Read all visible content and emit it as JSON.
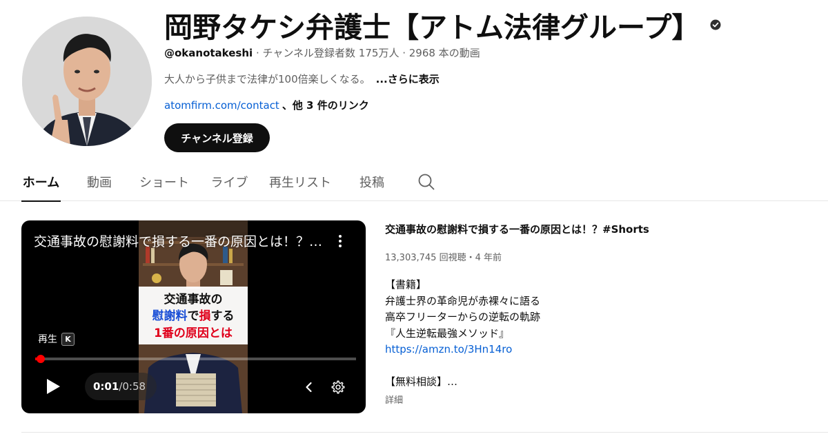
{
  "channel": {
    "title": "岡野タケシ弁護士【アトム法律グループ】",
    "handle": "@okanotakeshi",
    "meta_rest": " · チャンネル登録者数 175万人 · 2968 本の動画",
    "description": "大人から子供まで法律が100倍楽しくなる。",
    "more_label": "...さらに表示",
    "link_text": "atomfirm.com/contact",
    "other_links": "、他 3 件のリンク",
    "subscribe_label": "チャンネル登録",
    "verified_icon": "verified-check-icon"
  },
  "tabs": [
    {
      "label": "ホーム",
      "active": true
    },
    {
      "label": "動画"
    },
    {
      "label": "ショート"
    },
    {
      "label": "ライブ"
    },
    {
      "label": "再生リスト"
    },
    {
      "label": "投稿"
    }
  ],
  "player": {
    "overlay_title": "交通事故の慰謝料で損する一番の原因とは！？…",
    "thumbnail_caption": [
      "交通事故の",
      "慰謝料",
      "で",
      "損",
      "する",
      "1番の原因とは"
    ],
    "keyboard_hint": "再生",
    "keyboard_key": "K",
    "current_time": "0:01",
    "separator": " / ",
    "total_time": "0:58",
    "progress_fraction": 0.017
  },
  "video": {
    "title": "交通事故の慰謝料で損する一番の原因とは！？#Shorts",
    "stats": "13,303,745 回視聴・4 年前",
    "description_lines": [
      "【書籍】",
      "弁護士界の革命児が赤裸々に語る",
      "高卒フリーターからの逆転の軌跡",
      "『人生逆転最強メソッド』",
      "https://amzn.to/3Hn14ro",
      "",
      "【無料相談】…"
    ],
    "more_label": "詳細"
  },
  "colors": {
    "link": "#065fd4",
    "progress": "#ff0000",
    "caption_blue": "#1a4fd6",
    "caption_red": "#e0001b"
  }
}
